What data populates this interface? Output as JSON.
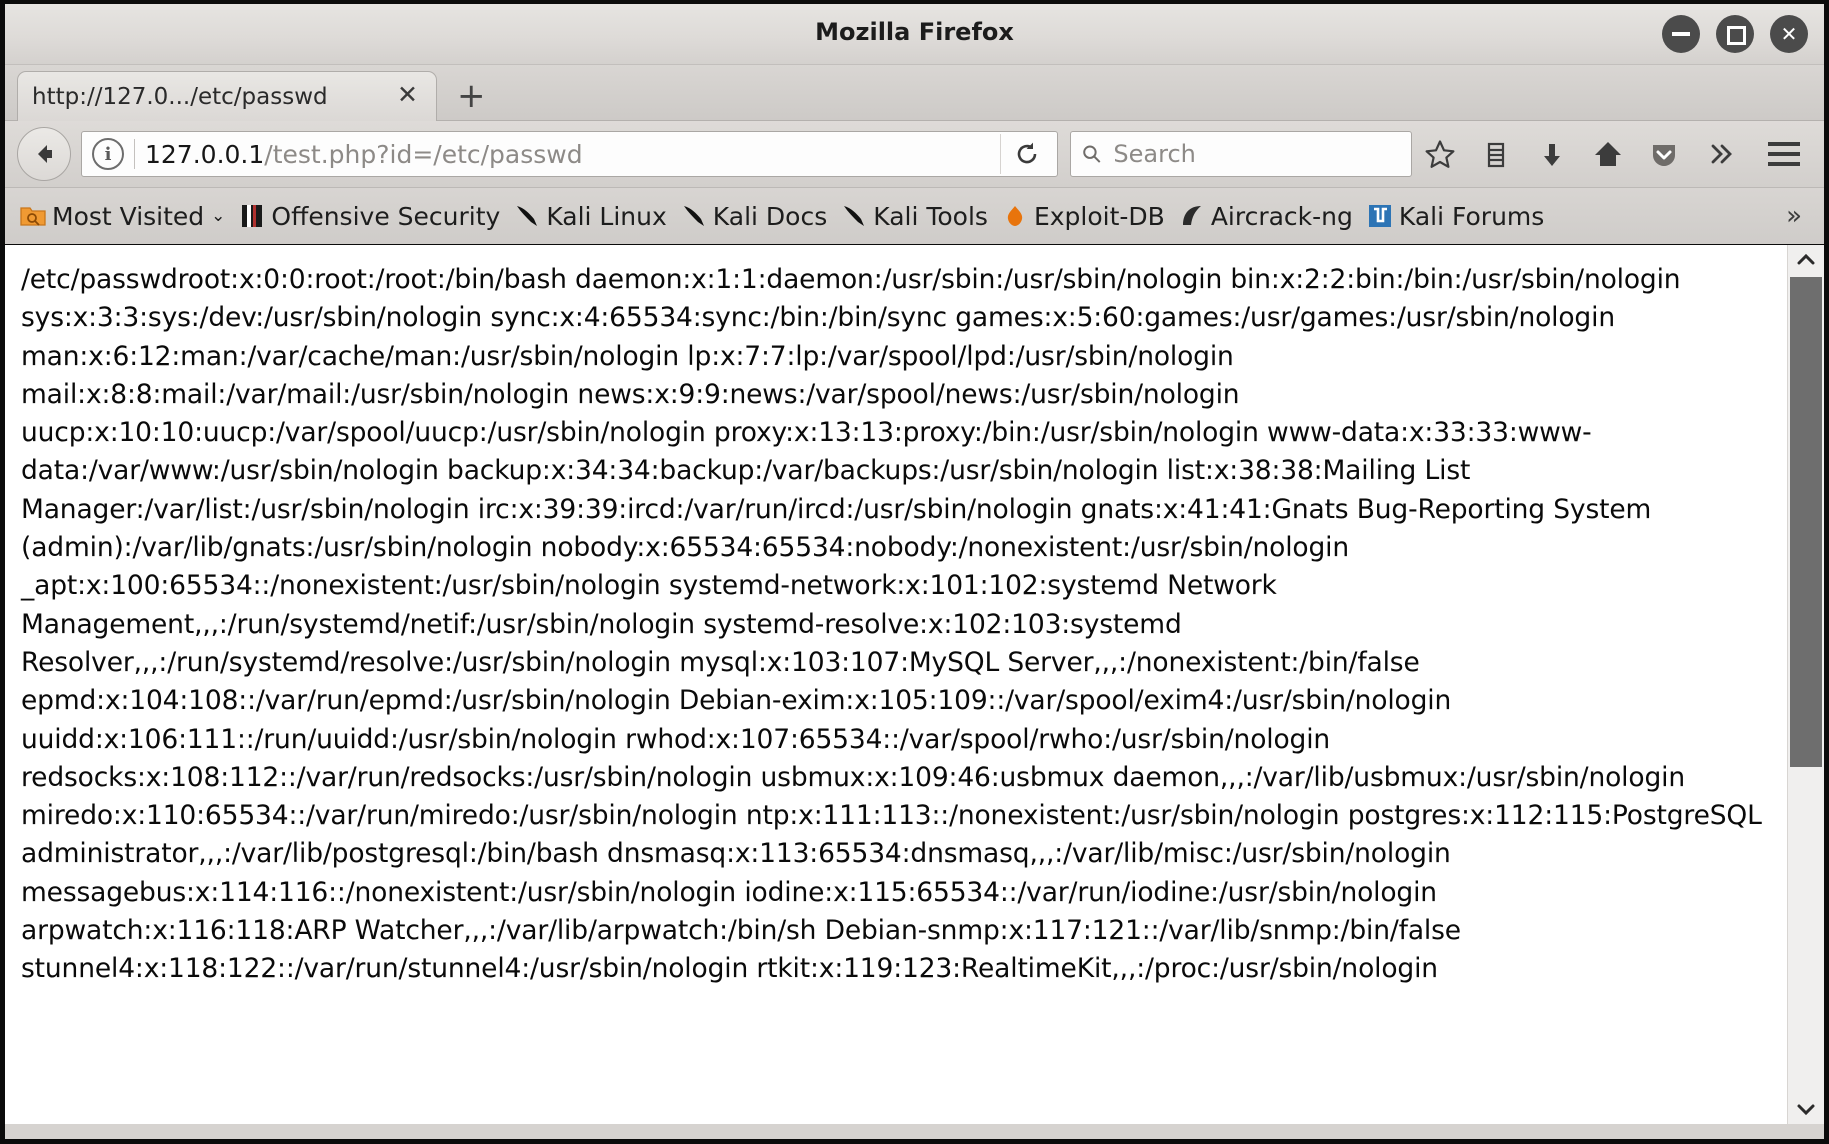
{
  "window": {
    "title": "Mozilla Firefox",
    "controls": [
      {
        "name": "minimize",
        "glyph": "minimize"
      },
      {
        "name": "maximize",
        "glyph": "maximize"
      },
      {
        "name": "close",
        "glyph": "✕"
      }
    ]
  },
  "tabs": {
    "active": {
      "title": "http://127.0.../etc/passwd",
      "close_label": "✕"
    },
    "new_tab_label": "+"
  },
  "toolbar": {
    "back_label": "←",
    "identity_label": "i",
    "url_host": "127.0.0.1",
    "url_path": "/test.php?id=/etc/passwd",
    "url_full": "127.0.0.1/test.php?id=/etc/passwd",
    "reload_label": "↻",
    "search_placeholder": "Search",
    "search_value": "",
    "icons": [
      {
        "name": "bookmark-star-icon",
        "label": "☆"
      },
      {
        "name": "library-icon",
        "label": "library"
      },
      {
        "name": "downloads-icon",
        "label": "↓"
      },
      {
        "name": "home-icon",
        "label": "home"
      },
      {
        "name": "pocket-icon",
        "label": "pocket"
      },
      {
        "name": "overflow-chevron-icon",
        "label": "»"
      }
    ],
    "menu_label": "menu"
  },
  "bookmarks": {
    "items": [
      {
        "label": "Most Visited",
        "icon": "most-visited-folder-icon",
        "chevron": "⌄"
      },
      {
        "label": "Offensive Security",
        "icon": "offensive-security-icon"
      },
      {
        "label": "Kali Linux",
        "icon": "kali-dragon-icon"
      },
      {
        "label": "Kali Docs",
        "icon": "kali-dragon-icon"
      },
      {
        "label": "Kali Tools",
        "icon": "kali-dragon-icon"
      },
      {
        "label": "Exploit-DB",
        "icon": "exploit-db-icon"
      },
      {
        "label": "Aircrack-ng",
        "icon": "aircrack-ng-icon"
      },
      {
        "label": "Kali Forums",
        "icon": "kali-forums-icon"
      }
    ],
    "overflow_label": "»"
  },
  "page": {
    "body_text": "/etc/passwdroot:x:0:0:root:/root:/bin/bash daemon:x:1:1:daemon:/usr/sbin:/usr/sbin/nologin bin:x:2:2:bin:/bin:/usr/sbin/nologin sys:x:3:3:sys:/dev:/usr/sbin/nologin sync:x:4:65534:sync:/bin:/bin/sync games:x:5:60:games:/usr/games:/usr/sbin/nologin man:x:6:12:man:/var/cache/man:/usr/sbin/nologin lp:x:7:7:lp:/var/spool/lpd:/usr/sbin/nologin mail:x:8:8:mail:/var/mail:/usr/sbin/nologin news:x:9:9:news:/var/spool/news:/usr/sbin/nologin uucp:x:10:10:uucp:/var/spool/uucp:/usr/sbin/nologin proxy:x:13:13:proxy:/bin:/usr/sbin/nologin www-data:x:33:33:www-data:/var/www:/usr/sbin/nologin backup:x:34:34:backup:/var/backups:/usr/sbin/nologin list:x:38:38:Mailing List Manager:/var/list:/usr/sbin/nologin irc:x:39:39:ircd:/var/run/ircd:/usr/sbin/nologin gnats:x:41:41:Gnats Bug-Reporting System (admin):/var/lib/gnats:/usr/sbin/nologin nobody:x:65534:65534:nobody:/nonexistent:/usr/sbin/nologin _apt:x:100:65534::/nonexistent:/usr/sbin/nologin systemd-network:x:101:102:systemd Network Management,,,:/run/systemd/netif:/usr/sbin/nologin systemd-resolve:x:102:103:systemd Resolver,,,:/run/systemd/resolve:/usr/sbin/nologin mysql:x:103:107:MySQL Server,,,:/nonexistent:/bin/false epmd:x:104:108::/var/run/epmd:/usr/sbin/nologin Debian-exim:x:105:109::/var/spool/exim4:/usr/sbin/nologin uuidd:x:106:111::/run/uuidd:/usr/sbin/nologin rwhod:x:107:65534::/var/spool/rwho:/usr/sbin/nologin redsocks:x:108:112::/var/run/redsocks:/usr/sbin/nologin usbmux:x:109:46:usbmux daemon,,,:/var/lib/usbmux:/usr/sbin/nologin miredo:x:110:65534::/var/run/miredo:/usr/sbin/nologin ntp:x:111:113::/nonexistent:/usr/sbin/nologin postgres:x:112:115:PostgreSQL administrator,,,:/var/lib/postgresql:/bin/bash dnsmasq:x:113:65534:dnsmasq,,,:/var/lib/misc:/usr/sbin/nologin messagebus:x:114:116::/nonexistent:/usr/sbin/nologin iodine:x:115:65534::/var/run/iodine:/usr/sbin/nologin arpwatch:x:116:118:ARP Watcher,,,:/var/lib/arpwatch:/bin/sh Debian-snmp:x:117:121::/var/lib/snmp:/bin/false stunnel4:x:118:122::/var/run/stunnel4:/usr/sbin/nologin rtkit:x:119:123:RealtimeKit,,,:/proc:/usr/sbin/nologin"
  },
  "scrollbar": {
    "up_label": "⌃",
    "down_label": "⌄",
    "thumb_position_percent": 0,
    "thumb_size_percent": 58
  },
  "colors": {
    "chrome": "#d6d3d0",
    "content_bg": "#ffffff",
    "text": "#0a0a0a",
    "url_host": "#161616",
    "url_path": "#8d8a87",
    "scrollbar_thumb": "#6e6e6e",
    "accent_orange": "#e8740c",
    "kali_blue": "#2d74b5"
  }
}
